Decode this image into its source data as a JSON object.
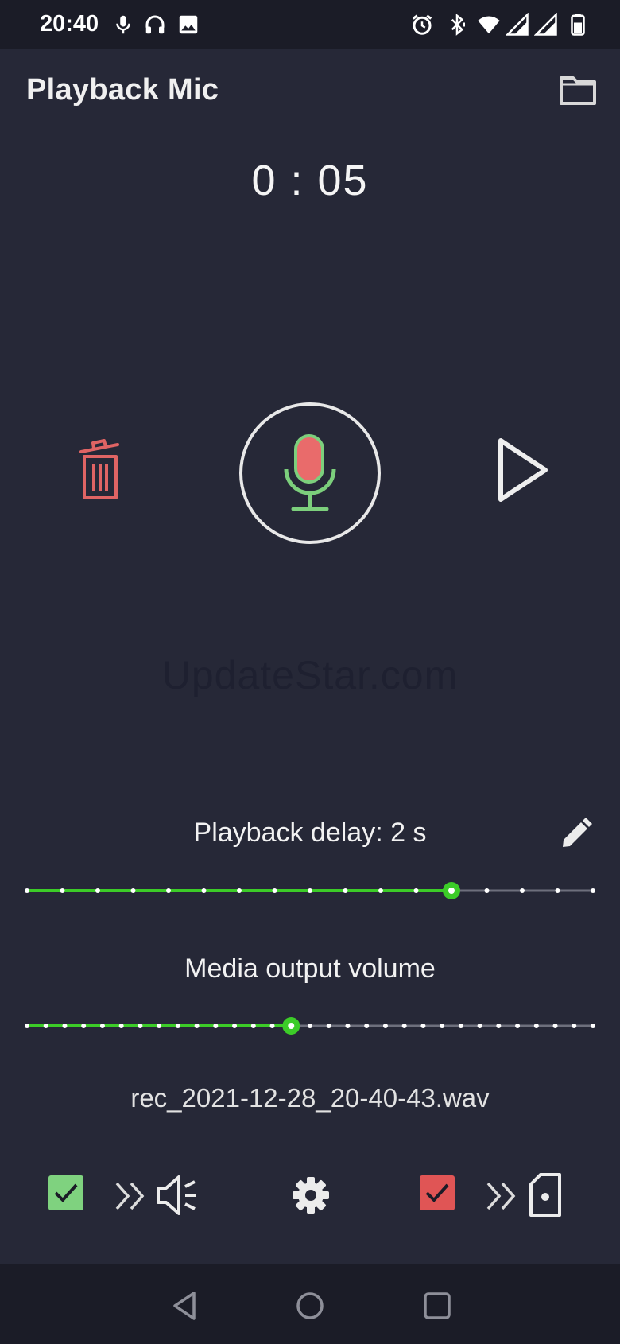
{
  "status": {
    "time": "20:40",
    "left_icons": [
      "mic-icon",
      "headphones-icon",
      "image-icon"
    ],
    "right_icons": [
      "alarm-icon",
      "bluetooth-icon",
      "wifi-icon",
      "signal-icon",
      "signal-roaming-icon",
      "battery-icon"
    ]
  },
  "app": {
    "title": "Playback Mic",
    "folder_icon": "folder-icon"
  },
  "timer": "0 : 05",
  "controls": {
    "delete_icon": "trash-icon",
    "record_icon": "mic-icon",
    "play_icon": "play-icon"
  },
  "watermark": "UpdateStar.com",
  "delay": {
    "label": "Playback delay: 2 s",
    "edit_icon": "pencil-icon",
    "steps": 17,
    "value_index": 12
  },
  "volume": {
    "label": "Media output volume",
    "steps": 31,
    "value_index": 14
  },
  "file": {
    "name": "rec_2021-12-28_20-40-43.wav"
  },
  "bottom": {
    "speaker_output_checked": true,
    "save_file_checked": true,
    "colors": {
      "speaker_check": "#7fd27f",
      "file_check": "#e05555",
      "accent": "#3ccc28"
    }
  },
  "nav": [
    "back-icon",
    "home-icon",
    "recents-icon"
  ]
}
